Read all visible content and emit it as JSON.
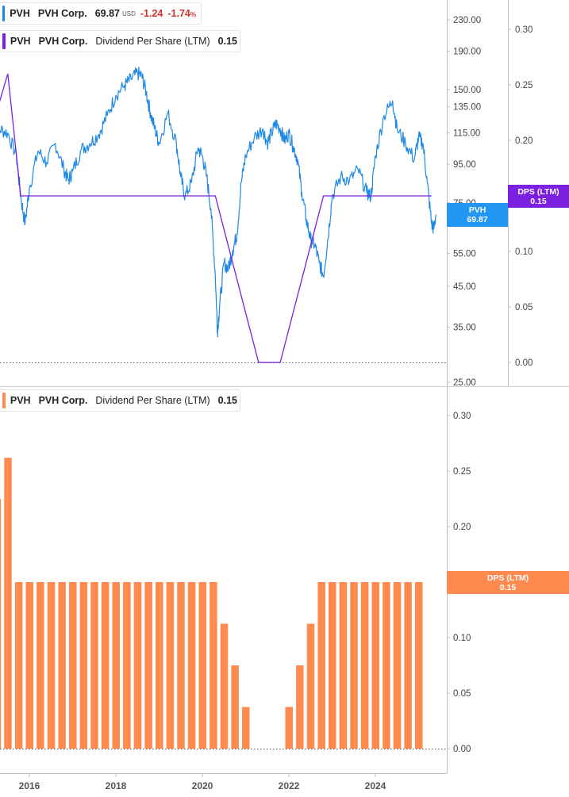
{
  "panel_top": {
    "legend_price": {
      "symbol": "PVH",
      "name": "PVH Corp.",
      "price": "69.87",
      "currency": "USD",
      "change": "-1.24",
      "change_pct": "-1.74",
      "pct_sign": "%",
      "color": "#1e88e5"
    },
    "legend_dps": {
      "symbol": "PVH",
      "name": "PVH Corp.",
      "metric": "Dividend Per Share (LTM)",
      "value": "0.15",
      "color": "#7b1fe0"
    },
    "tag_price": {
      "label": "PVH",
      "value": "69.87",
      "color": "#2196f3"
    },
    "tag_dps": {
      "label": "DPS (LTM)",
      "value": "0.15",
      "color": "#7b1fe0"
    }
  },
  "panel_bottom": {
    "legend": {
      "symbol": "PVH",
      "name": "PVH Corp.",
      "metric": "Dividend Per Share (LTM)",
      "value": "0.15",
      "color": "#ff8a50"
    },
    "tag_dps": {
      "label": "DPS (LTM)",
      "value": "0.15",
      "color": "#ff8a50"
    }
  },
  "chart_data": [
    {
      "type": "line",
      "title": "",
      "series": [
        {
          "name": "PVH Corp.",
          "color": "#1e88e5",
          "points": [
            [
              2015.0,
              100
            ],
            [
              2015.3,
              118
            ],
            [
              2015.5,
              115
            ],
            [
              2015.7,
              100
            ],
            [
              2015.8,
              78
            ],
            [
              2015.9,
              66
            ],
            [
              2016.0,
              82
            ],
            [
              2016.2,
              103
            ],
            [
              2016.4,
              96
            ],
            [
              2016.6,
              108
            ],
            [
              2016.8,
              92
            ],
            [
              2016.9,
              86
            ],
            [
              2017.0,
              91
            ],
            [
              2017.2,
              104
            ],
            [
              2017.4,
              108
            ],
            [
              2017.6,
              114
            ],
            [
              2017.8,
              128
            ],
            [
              2018.0,
              145
            ],
            [
              2018.2,
              154
            ],
            [
              2018.35,
              160
            ],
            [
              2018.5,
              166
            ],
            [
              2018.6,
              163
            ],
            [
              2018.7,
              148
            ],
            [
              2018.8,
              130
            ],
            [
              2018.9,
              118
            ],
            [
              2019.0,
              108
            ],
            [
              2019.2,
              130
            ],
            [
              2019.4,
              108
            ],
            [
              2019.5,
              88
            ],
            [
              2019.6,
              78
            ],
            [
              2019.75,
              85
            ],
            [
              2019.9,
              105
            ],
            [
              2020.0,
              100
            ],
            [
              2020.1,
              88
            ],
            [
              2020.2,
              72
            ],
            [
              2020.3,
              48
            ],
            [
              2020.35,
              34
            ],
            [
              2020.4,
              40
            ],
            [
              2020.5,
              52
            ],
            [
              2020.6,
              50
            ],
            [
              2020.7,
              56
            ],
            [
              2020.8,
              62
            ],
            [
              2020.9,
              85
            ],
            [
              2021.0,
              100
            ],
            [
              2021.2,
              112
            ],
            [
              2021.4,
              118
            ],
            [
              2021.5,
              108
            ],
            [
              2021.6,
              115
            ],
            [
              2021.7,
              122
            ],
            [
              2021.8,
              118
            ],
            [
              2021.9,
              110
            ],
            [
              2022.0,
              115
            ],
            [
              2022.1,
              106
            ],
            [
              2022.2,
              98
            ],
            [
              2022.3,
              80
            ],
            [
              2022.4,
              68
            ],
            [
              2022.5,
              60
            ],
            [
              2022.6,
              58
            ],
            [
              2022.7,
              52
            ],
            [
              2022.8,
              48
            ],
            [
              2022.9,
              60
            ],
            [
              2023.0,
              78
            ],
            [
              2023.2,
              88
            ],
            [
              2023.4,
              86
            ],
            [
              2023.6,
              92
            ],
            [
              2023.8,
              80
            ],
            [
              2023.9,
              78
            ],
            [
              2024.0,
              100
            ],
            [
              2024.2,
              128
            ],
            [
              2024.4,
              140
            ],
            [
              2024.5,
              118
            ],
            [
              2024.7,
              108
            ],
            [
              2024.9,
              98
            ],
            [
              2025.0,
              112
            ],
            [
              2025.1,
              108
            ],
            [
              2025.2,
              85
            ],
            [
              2025.3,
              66
            ],
            [
              2025.35,
              64
            ],
            [
              2025.4,
              69.87
            ]
          ]
        },
        {
          "name": "Dividend Per Share (LTM)",
          "color": "#7b1fe0",
          "points": [
            [
              2014.97,
              0.15
            ],
            [
              2015.2,
              0.22
            ],
            [
              2015.5,
              0.26
            ],
            [
              2015.8,
              0.15
            ],
            [
              2020.3,
              0.15
            ],
            [
              2021.3,
              0.0
            ],
            [
              2021.8,
              0.0
            ],
            [
              2022.8,
              0.15
            ],
            [
              2025.3,
              0.15
            ]
          ]
        }
      ],
      "yaxis_left": {
        "scale": "log",
        "ticks": [
          230,
          190,
          150,
          135,
          115,
          95,
          75,
          55,
          45,
          35,
          25
        ]
      },
      "yaxis_right": {
        "ticks": [
          0.3,
          0.25,
          0.2,
          0.15,
          0.1,
          0.05,
          0.0
        ]
      }
    },
    {
      "type": "bar",
      "title": "",
      "series": [
        {
          "name": "Dividend Per Share (LTM)",
          "color": "#ff8a50",
          "points": [
            [
              2015.0,
              0.15
            ],
            [
              2015.25,
              0.225
            ],
            [
              2015.5,
              0.262
            ],
            [
              2015.75,
              0.15
            ],
            [
              2016.0,
              0.15
            ],
            [
              2016.25,
              0.15
            ],
            [
              2016.5,
              0.15
            ],
            [
              2016.75,
              0.15
            ],
            [
              2017.0,
              0.15
            ],
            [
              2017.25,
              0.15
            ],
            [
              2017.5,
              0.15
            ],
            [
              2017.75,
              0.15
            ],
            [
              2018.0,
              0.15
            ],
            [
              2018.25,
              0.15
            ],
            [
              2018.5,
              0.15
            ],
            [
              2018.75,
              0.15
            ],
            [
              2019.0,
              0.15
            ],
            [
              2019.25,
              0.15
            ],
            [
              2019.5,
              0.15
            ],
            [
              2019.75,
              0.15
            ],
            [
              2020.0,
              0.15
            ],
            [
              2020.25,
              0.15
            ],
            [
              2020.5,
              0.1125
            ],
            [
              2020.75,
              0.075
            ],
            [
              2021.0,
              0.0375
            ],
            [
              2022.0,
              0.0375
            ],
            [
              2022.25,
              0.075
            ],
            [
              2022.5,
              0.1125
            ],
            [
              2022.75,
              0.15
            ],
            [
              2023.0,
              0.15
            ],
            [
              2023.25,
              0.15
            ],
            [
              2023.5,
              0.15
            ],
            [
              2023.75,
              0.15
            ],
            [
              2024.0,
              0.15
            ],
            [
              2024.25,
              0.15
            ],
            [
              2024.5,
              0.15
            ],
            [
              2024.75,
              0.15
            ],
            [
              2025.0,
              0.15
            ]
          ]
        }
      ],
      "yaxis": {
        "ticks": [
          0.3,
          0.25,
          0.2,
          0.15,
          0.1,
          0.05,
          0.0
        ]
      },
      "xaxis": {
        "ticks": [
          "2016",
          "2018",
          "2020",
          "2022",
          "2024"
        ]
      }
    }
  ]
}
